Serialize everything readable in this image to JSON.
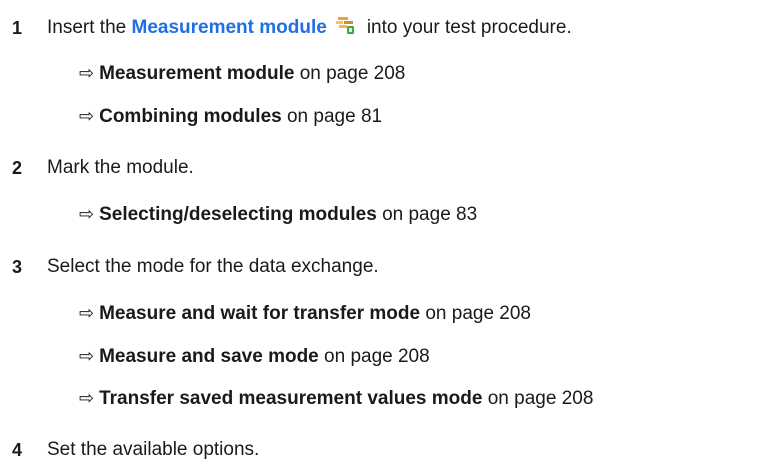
{
  "steps": [
    {
      "number": "1",
      "pre_text": "Insert the ",
      "link_text": "Measurement module",
      "icon": "measurement-module-icon",
      "post_text": "into your test procedure.",
      "refs": [
        {
          "arrow": "⇨",
          "title": "Measurement module",
          "page_text": " on page 208"
        },
        {
          "arrow": "⇨",
          "title": "Combining modules",
          "page_text": " on page 81"
        }
      ]
    },
    {
      "number": "2",
      "text": "Mark the module.",
      "refs": [
        {
          "arrow": "⇨",
          "title": "Selecting/deselecting modules",
          "page_text": " on page 83"
        }
      ]
    },
    {
      "number": "3",
      "text": "Select the mode for the data exchange.",
      "refs": [
        {
          "arrow": "⇨",
          "title": "Measure and wait for transfer mode",
          "page_text": " on page 208"
        },
        {
          "arrow": "⇨",
          "title": "Measure and save mode",
          "page_text": " on page 208"
        },
        {
          "arrow": "⇨",
          "title": "Transfer saved measurement values mode",
          "page_text": " on page 208"
        }
      ]
    },
    {
      "number": "4",
      "text": "Set the available options.",
      "refs": []
    }
  ],
  "colors": {
    "link": "#1f6fe5",
    "text": "#1a1a1a"
  }
}
